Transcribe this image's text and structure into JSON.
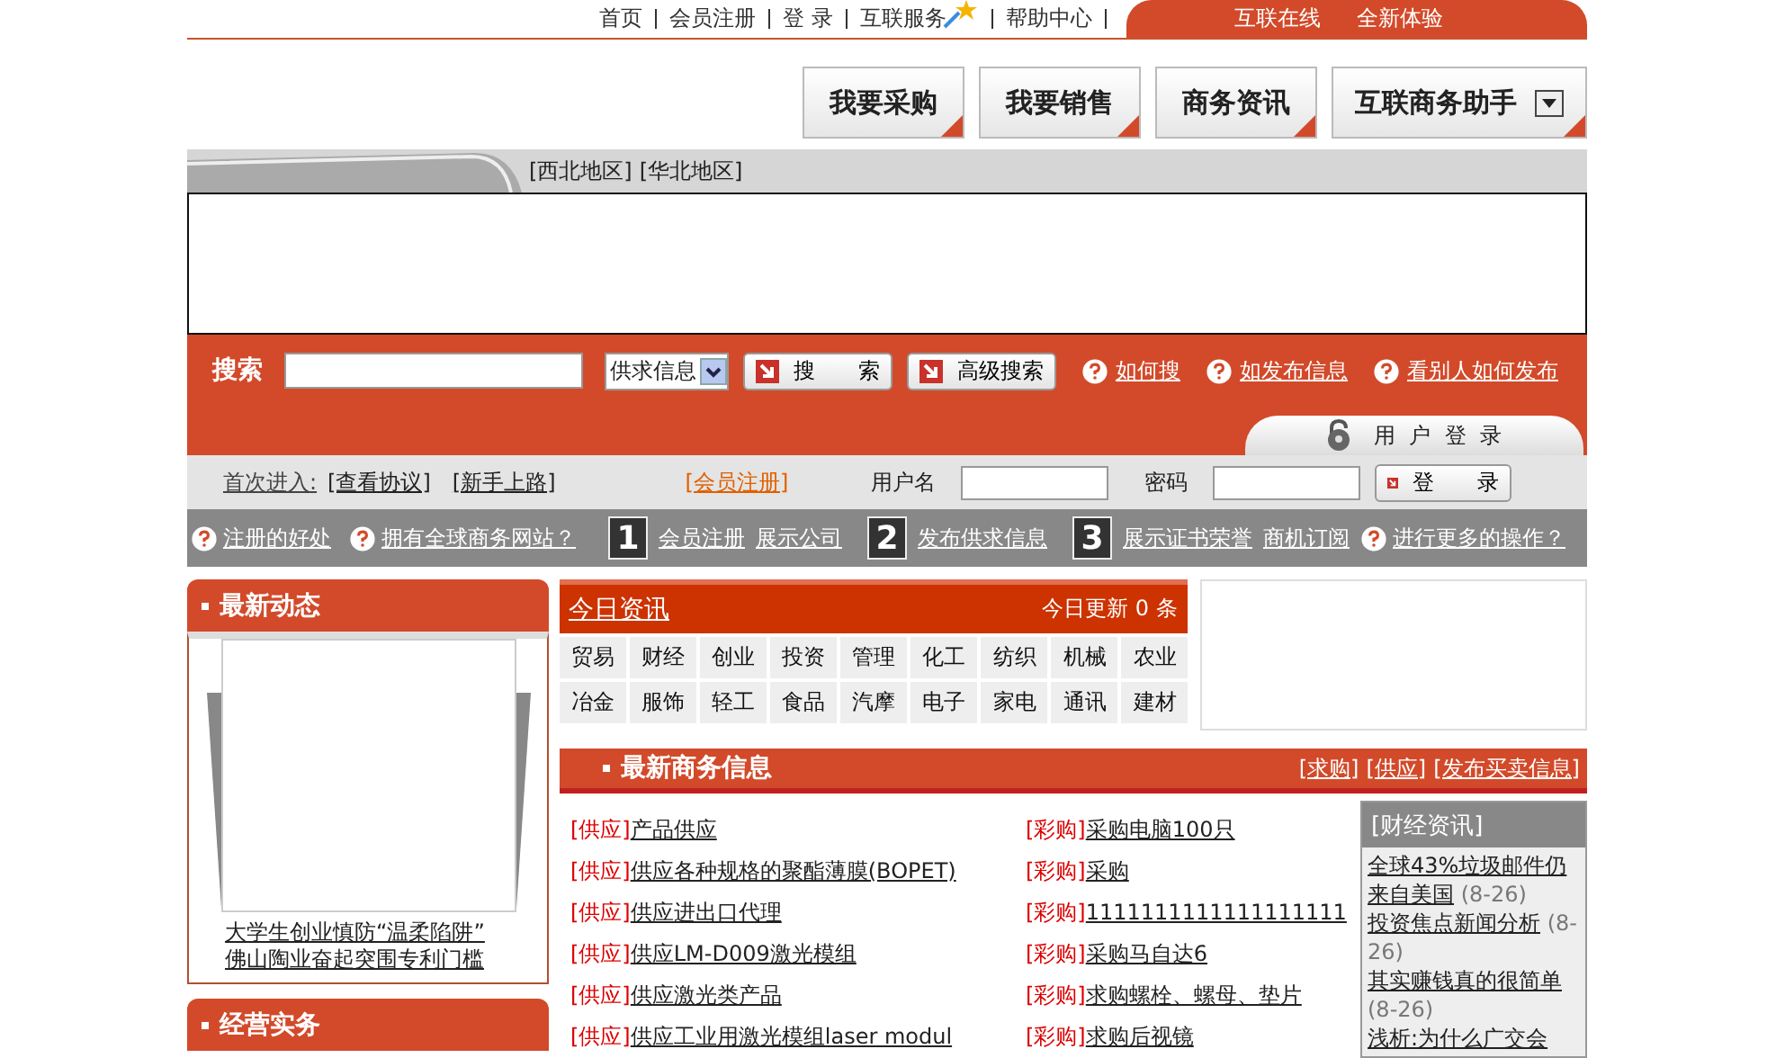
{
  "top_nav": {
    "links": [
      "首页",
      "会员注册",
      "登  录",
      "互联服务",
      "帮助中心"
    ],
    "tagline": [
      "互联在线",
      "全新体验"
    ]
  },
  "main_buttons": [
    {
      "label": "我要采购",
      "kind": "button"
    },
    {
      "label": "我要销售",
      "kind": "button"
    },
    {
      "label": "商务资讯",
      "kind": "button"
    },
    {
      "label": "互联商务助手",
      "kind": "dropdown"
    }
  ],
  "region_bar": {
    "links": [
      "[西北地区]",
      "[华北地区]"
    ]
  },
  "search": {
    "label": "搜索",
    "category": "供求信息",
    "buttons": [
      "搜　　索",
      "高级搜索"
    ],
    "help_links": [
      "如何搜",
      "如发布信息",
      "看别人如何发布"
    ]
  },
  "login": {
    "tab_title": "用 户 登 录",
    "first_visit": "首次进入:",
    "links": [
      "[查看协议]",
      "[新手上路]"
    ],
    "register": "[会员注册]",
    "username_label": "用户名",
    "password_label": "密码",
    "button": "登　　录"
  },
  "help_bar": [
    {
      "kind": "help",
      "text": "注册的好处"
    },
    {
      "kind": "help",
      "text": "拥有全球商务网站？"
    },
    {
      "kind": "step",
      "text": "1"
    },
    {
      "kind": "link",
      "text": "会员注册"
    },
    {
      "kind": "link",
      "text": "展示公司"
    },
    {
      "kind": "step",
      "text": "2"
    },
    {
      "kind": "link",
      "text": "发布供求信息"
    },
    {
      "kind": "step",
      "text": "3"
    },
    {
      "kind": "link",
      "text": "展示证书荣誉"
    },
    {
      "kind": "link",
      "text": "商机订阅"
    },
    {
      "kind": "help",
      "text": "进行更多的操作？"
    }
  ],
  "news_panel": {
    "title": "最新动态",
    "links": [
      "大学生创业慎防“温柔陷阱”",
      "佛山陶业奋起突围专利门槛"
    ]
  },
  "practice_panel": {
    "title": "经营实务"
  },
  "today": {
    "title": "今日资讯",
    "update": "今日更新 0 条",
    "categories": [
      [
        "贸易",
        "财经",
        "创业",
        "投资",
        "管理",
        "化工",
        "纺织",
        "机械",
        "农业"
      ],
      [
        "冶金",
        "服饰",
        "轻工",
        "食品",
        "汽摩",
        "电子",
        "家电",
        "通讯",
        "建材"
      ]
    ]
  },
  "business": {
    "title": "最新商务信息",
    "links": [
      "[求购]",
      "[供应]",
      "[发布买卖信息]"
    ],
    "supply": [
      {
        "tag": "[供应]",
        "text": "产品供应"
      },
      {
        "tag": "[供应]",
        "text": "供应各种规格的聚酯薄膜(BOPET)"
      },
      {
        "tag": "[供应]",
        "text": "供应进出口代理"
      },
      {
        "tag": "[供应]",
        "text": "供应LM-D009激光模组"
      },
      {
        "tag": "[供应]",
        "text": "供应激光类产品"
      },
      {
        "tag": "[供应]",
        "text": "供应工业用激光模组laser modul"
      }
    ],
    "purchase": [
      {
        "tag": "[彩购]",
        "text": "采购电脑100只"
      },
      {
        "tag": "[彩购]",
        "text": "采购"
      },
      {
        "tag": "[彩购]",
        "text": "1111111111111111111"
      },
      {
        "tag": "[彩购]",
        "text": "采购马自达6"
      },
      {
        "tag": "[彩购]",
        "text": "求购螺栓、螺母、垫片"
      },
      {
        "tag": "[彩购]",
        "text": "求购后视镜"
      }
    ]
  },
  "finance": {
    "title": "[财经资讯]",
    "items": [
      {
        "title": "全球43%垃圾邮件仍来自美国",
        "date": "(8-26)"
      },
      {
        "title": "投资焦点新闻分析",
        "date": "(8-26)"
      },
      {
        "title": "其实赚钱真的很简单",
        "date": "(8-26)"
      },
      {
        "title": "浅析:为什么广交会"
      }
    ]
  }
}
